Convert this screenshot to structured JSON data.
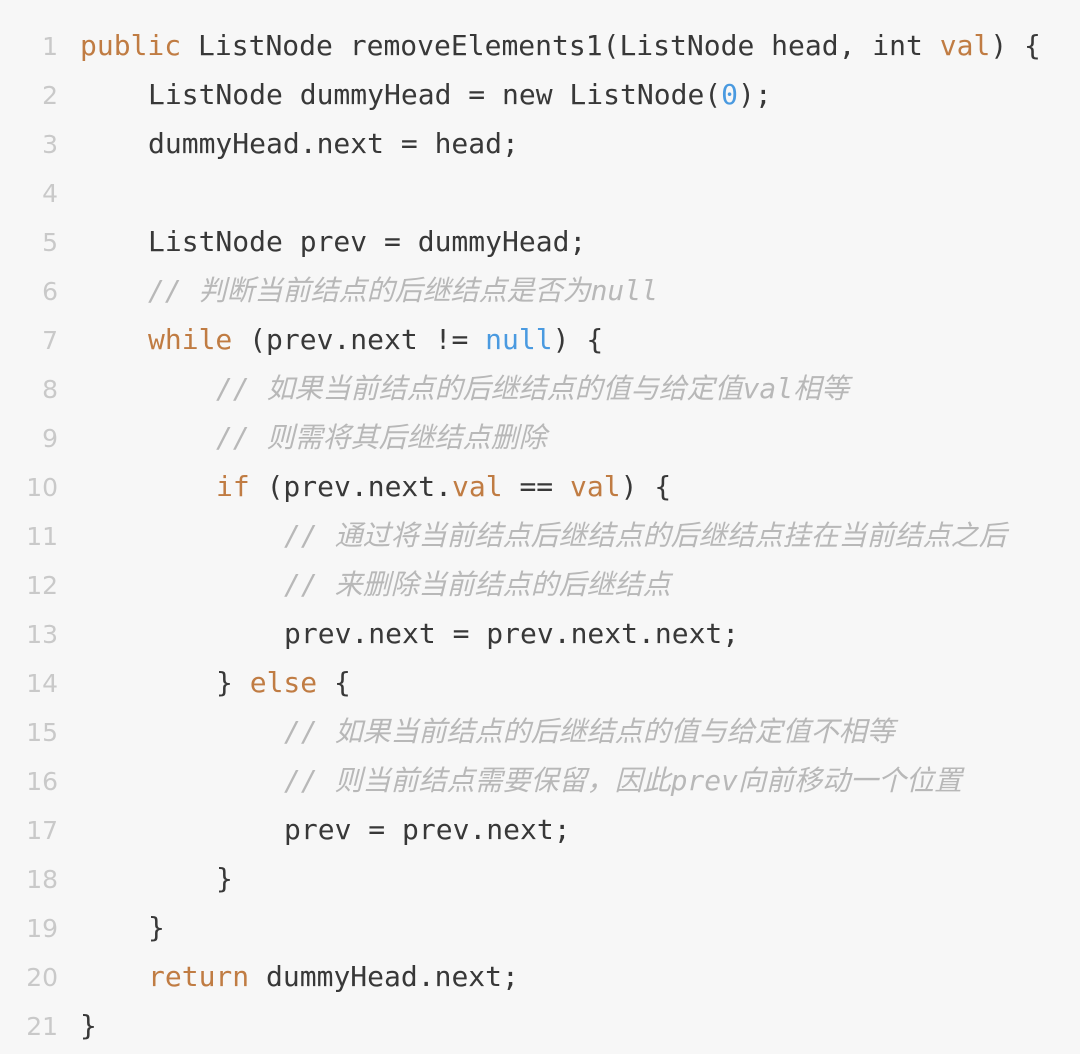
{
  "editor": {
    "language": "java",
    "background_color": "#f7f7f7",
    "text_color": "#383838",
    "keyword_color": "#c07c43",
    "literal_color": "#4a9ae0",
    "comment_color": "#b8b8b8",
    "line_number_color": "#c9c9c9",
    "first_line_number": 1,
    "last_line_number": 21,
    "total_lines": 21
  },
  "lines": [
    {
      "number": "1",
      "indent": 0,
      "tokens": [
        {
          "text": "public",
          "type": "kw"
        },
        {
          "text": " ListNode removeElements1(ListNode head, int ",
          "type": "plain"
        },
        {
          "text": "val",
          "type": "kw"
        },
        {
          "text": ") {",
          "type": "plain"
        }
      ]
    },
    {
      "number": "2",
      "indent": 4,
      "tokens": [
        {
          "text": "ListNode dummyHead = new ListNode(",
          "type": "plain"
        },
        {
          "text": "0",
          "type": "literal"
        },
        {
          "text": ");",
          "type": "plain"
        }
      ]
    },
    {
      "number": "3",
      "indent": 4,
      "tokens": [
        {
          "text": "dummyHead.next = head;",
          "type": "plain"
        }
      ]
    },
    {
      "number": "4",
      "indent": 0,
      "tokens": []
    },
    {
      "number": "5",
      "indent": 4,
      "tokens": [
        {
          "text": "ListNode prev = dummyHead;",
          "type": "plain"
        }
      ]
    },
    {
      "number": "6",
      "indent": 4,
      "tokens": [
        {
          "text": "// 判断当前结点的后继结点是否为null",
          "type": "comment"
        }
      ]
    },
    {
      "number": "7",
      "indent": 4,
      "tokens": [
        {
          "text": "while",
          "type": "kw"
        },
        {
          "text": " (prev.next != ",
          "type": "plain"
        },
        {
          "text": "null",
          "type": "literal"
        },
        {
          "text": ") {",
          "type": "plain"
        }
      ]
    },
    {
      "number": "8",
      "indent": 8,
      "tokens": [
        {
          "text": "// 如果当前结点的后继结点的值与给定值val相等",
          "type": "comment"
        }
      ]
    },
    {
      "number": "9",
      "indent": 8,
      "tokens": [
        {
          "text": "// 则需将其后继结点删除",
          "type": "comment"
        }
      ]
    },
    {
      "number": "10",
      "indent": 8,
      "tokens": [
        {
          "text": "if",
          "type": "kw"
        },
        {
          "text": " (prev.next.",
          "type": "plain"
        },
        {
          "text": "val",
          "type": "kw"
        },
        {
          "text": " == ",
          "type": "plain"
        },
        {
          "text": "val",
          "type": "kw"
        },
        {
          "text": ") {",
          "type": "plain"
        }
      ]
    },
    {
      "number": "11",
      "indent": 12,
      "tokens": [
        {
          "text": "// 通过将当前结点后继结点的后继结点挂在当前结点之后",
          "type": "comment"
        }
      ]
    },
    {
      "number": "12",
      "indent": 12,
      "tokens": [
        {
          "text": "// 来删除当前结点的后继结点",
          "type": "comment"
        }
      ]
    },
    {
      "number": "13",
      "indent": 12,
      "tokens": [
        {
          "text": "prev.next = prev.next.next;",
          "type": "plain"
        }
      ]
    },
    {
      "number": "14",
      "indent": 8,
      "tokens": [
        {
          "text": "} ",
          "type": "plain"
        },
        {
          "text": "else",
          "type": "kw"
        },
        {
          "text": " {",
          "type": "plain"
        }
      ]
    },
    {
      "number": "15",
      "indent": 12,
      "tokens": [
        {
          "text": "// 如果当前结点的后继结点的值与给定值不相等",
          "type": "comment"
        }
      ]
    },
    {
      "number": "16",
      "indent": 12,
      "tokens": [
        {
          "text": "// 则当前结点需要保留，因此prev向前移动一个位置",
          "type": "comment"
        }
      ]
    },
    {
      "number": "17",
      "indent": 12,
      "tokens": [
        {
          "text": "prev = prev.next;",
          "type": "plain"
        }
      ]
    },
    {
      "number": "18",
      "indent": 8,
      "tokens": [
        {
          "text": "}",
          "type": "plain"
        }
      ]
    },
    {
      "number": "19",
      "indent": 4,
      "tokens": [
        {
          "text": "}",
          "type": "plain"
        }
      ]
    },
    {
      "number": "20",
      "indent": 4,
      "tokens": [
        {
          "text": "return",
          "type": "kw"
        },
        {
          "text": " dummyHead.next;",
          "type": "plain"
        }
      ]
    },
    {
      "number": "21",
      "indent": 0,
      "tokens": [
        {
          "text": "}",
          "type": "plain"
        }
      ]
    }
  ]
}
